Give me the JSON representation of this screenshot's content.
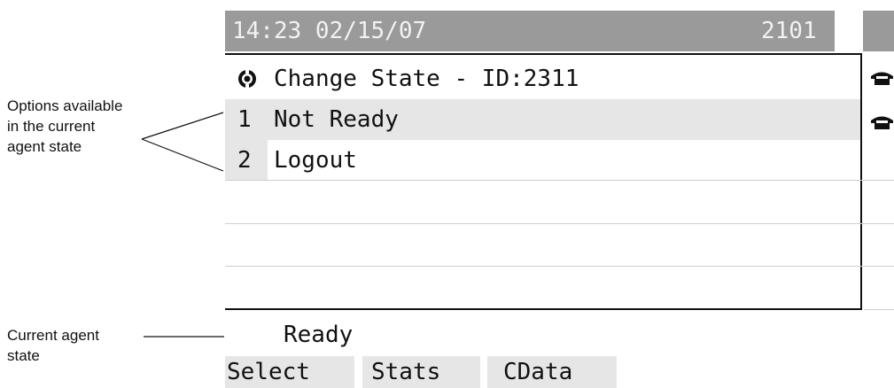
{
  "callouts": {
    "options": [
      "Options available",
      "in the current",
      "agent state"
    ],
    "current": [
      "Current agent",
      "state"
    ]
  },
  "status_bar": {
    "time_date": "14:23 02/15/07",
    "extension": "2101"
  },
  "menu": {
    "title": "Change State - ID:2311",
    "title_icon": "agent-state-icon",
    "items": [
      {
        "num": "1",
        "label": "Not Ready"
      },
      {
        "num": "2",
        "label": "Logout"
      }
    ]
  },
  "line_icons": [
    "phone-icon",
    "phone-icon"
  ],
  "agent_state": "Ready",
  "softkeys": [
    "Select",
    "Stats",
    "CData"
  ],
  "colors": {
    "status_bar": "#9a9a9a",
    "highlight": "#e6e6e6",
    "text": "#111111"
  }
}
